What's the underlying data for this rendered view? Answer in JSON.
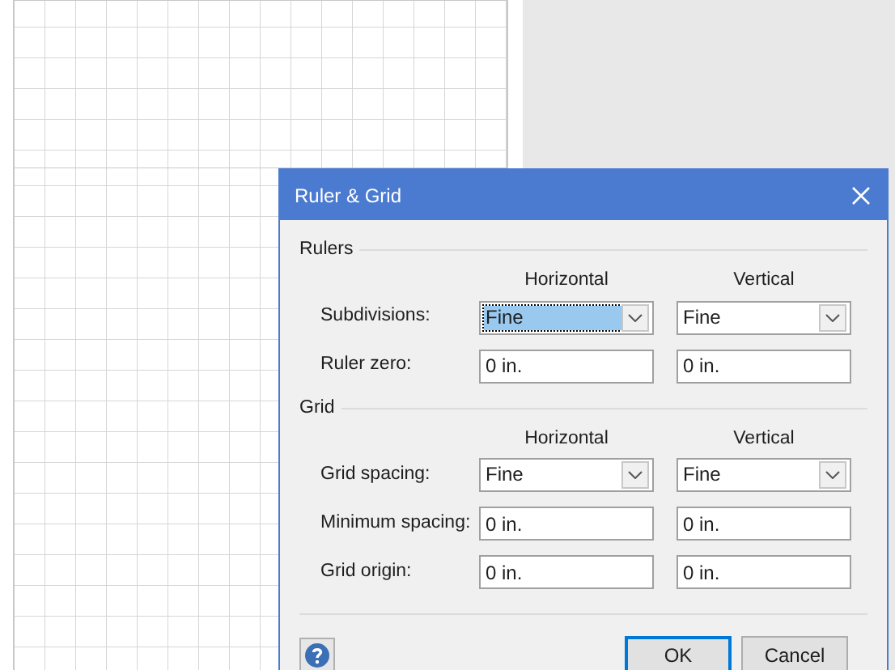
{
  "dialog": {
    "title": "Ruler & Grid",
    "sections": [
      {
        "title": "Rulers",
        "columns": [
          "Horizontal",
          "Vertical"
        ],
        "rows": [
          {
            "label": "Subdivisions:",
            "kind": "dropdown",
            "fields": [
              {
                "value": "Fine",
                "focused": true
              },
              {
                "value": "Fine",
                "focused": false
              }
            ]
          },
          {
            "label": "Ruler zero:",
            "kind": "text",
            "fields": [
              {
                "value": "0 in.",
                "focused": false
              },
              {
                "value": "0 in.",
                "focused": false
              }
            ]
          }
        ]
      },
      {
        "title": "Grid",
        "columns": [
          "Horizontal",
          "Vertical"
        ],
        "rows": [
          {
            "label": "Grid spacing:",
            "kind": "dropdown",
            "fields": [
              {
                "value": "Fine",
                "focused": false
              },
              {
                "value": "Fine",
                "focused": false
              }
            ]
          },
          {
            "label": "Minimum spacing:",
            "kind": "text",
            "fields": [
              {
                "value": "0 in.",
                "focused": false
              },
              {
                "value": "0 in.",
                "focused": false
              }
            ]
          },
          {
            "label": "Grid origin:",
            "kind": "text",
            "fields": [
              {
                "value": "0 in.",
                "focused": false
              },
              {
                "value": "0 in.",
                "focused": false
              }
            ]
          }
        ]
      }
    ],
    "buttons": [
      {
        "label": "OK",
        "default": true
      },
      {
        "label": "Cancel",
        "default": false
      }
    ]
  }
}
